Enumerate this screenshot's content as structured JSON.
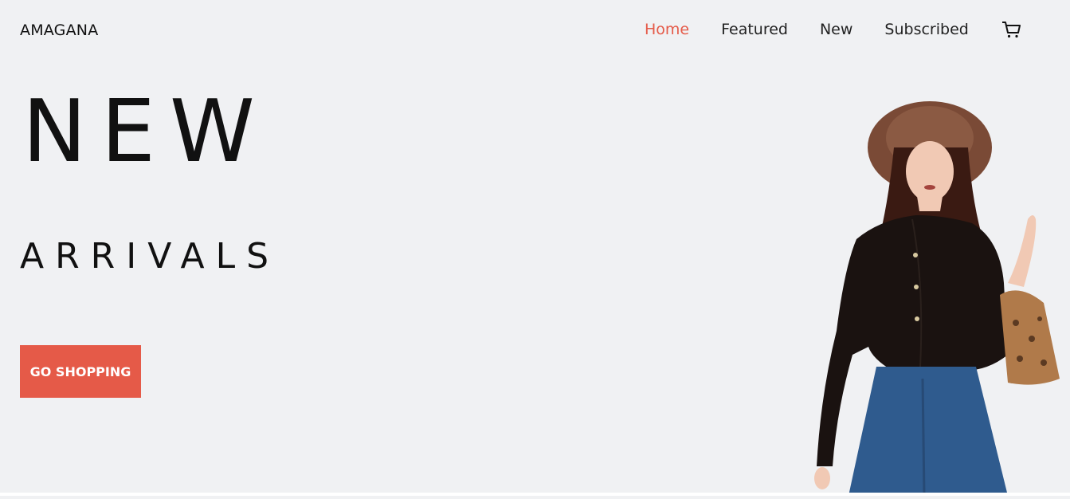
{
  "brand": "AMAGANA",
  "nav": {
    "items": [
      {
        "label": "Home",
        "active": true
      },
      {
        "label": "Featured",
        "active": false
      },
      {
        "label": "New",
        "active": false
      },
      {
        "label": "Subscribed",
        "active": false
      }
    ],
    "cart_icon": "shopping-cart-icon"
  },
  "hero": {
    "headline": "NEW",
    "subheadline": "ARRIVALS",
    "cta_label": "GO SHOPPING"
  },
  "colors": {
    "background": "#f0f1f3",
    "accent": "#e55a48",
    "text": "#111111"
  }
}
